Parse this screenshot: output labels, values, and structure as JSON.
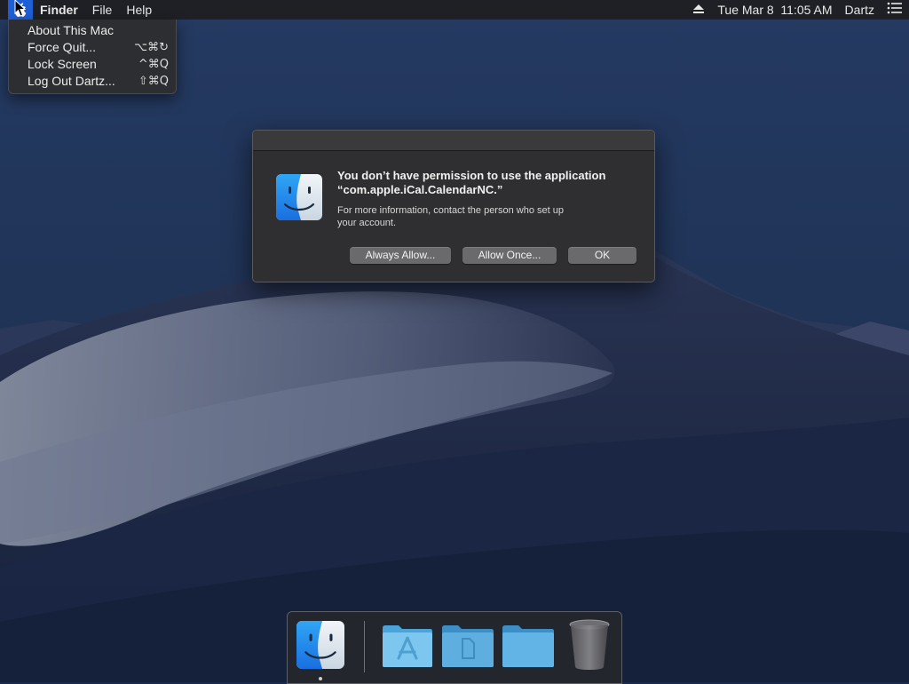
{
  "menubar": {
    "apple_icon": "apple-logo-icon",
    "app_name": "Finder",
    "menus": [
      "File",
      "Help"
    ],
    "eject_icon": "eject-icon",
    "datetime": "Tue Mar 8  11:05 AM",
    "user": "Dartz",
    "list_icon": "notification-list-icon"
  },
  "apple_menu": {
    "items": [
      {
        "label": "About This Mac",
        "shortcut": ""
      },
      {
        "label": "Force Quit...",
        "shortcut": "⌥⌘↻"
      },
      {
        "label": "Lock Screen",
        "shortcut": "^⌘Q"
      },
      {
        "label": "Log Out Dartz...",
        "shortcut": "⇧⌘Q"
      }
    ]
  },
  "dialog": {
    "title_line1": "You don’t have permission to use the application",
    "title_line2": "“com.apple.iCal.CalendarNC.”",
    "message_line1": "For more information, contact the person who set up",
    "message_line2": "your account.",
    "buttons": {
      "always_allow": "Always Allow...",
      "allow_once": "Allow Once...",
      "ok": "OK"
    },
    "icon": "finder-icon"
  },
  "dock": {
    "items": [
      "finder-icon",
      "applications-folder-icon",
      "documents-folder-icon",
      "downloads-folder-icon",
      "trash-icon"
    ]
  },
  "colors": {
    "menu_highlight": "#1f5fd6",
    "dialog_bg": "#2f2f31",
    "button_bg": "#6a6a6c",
    "folder_blue": "#5fb6e6"
  }
}
